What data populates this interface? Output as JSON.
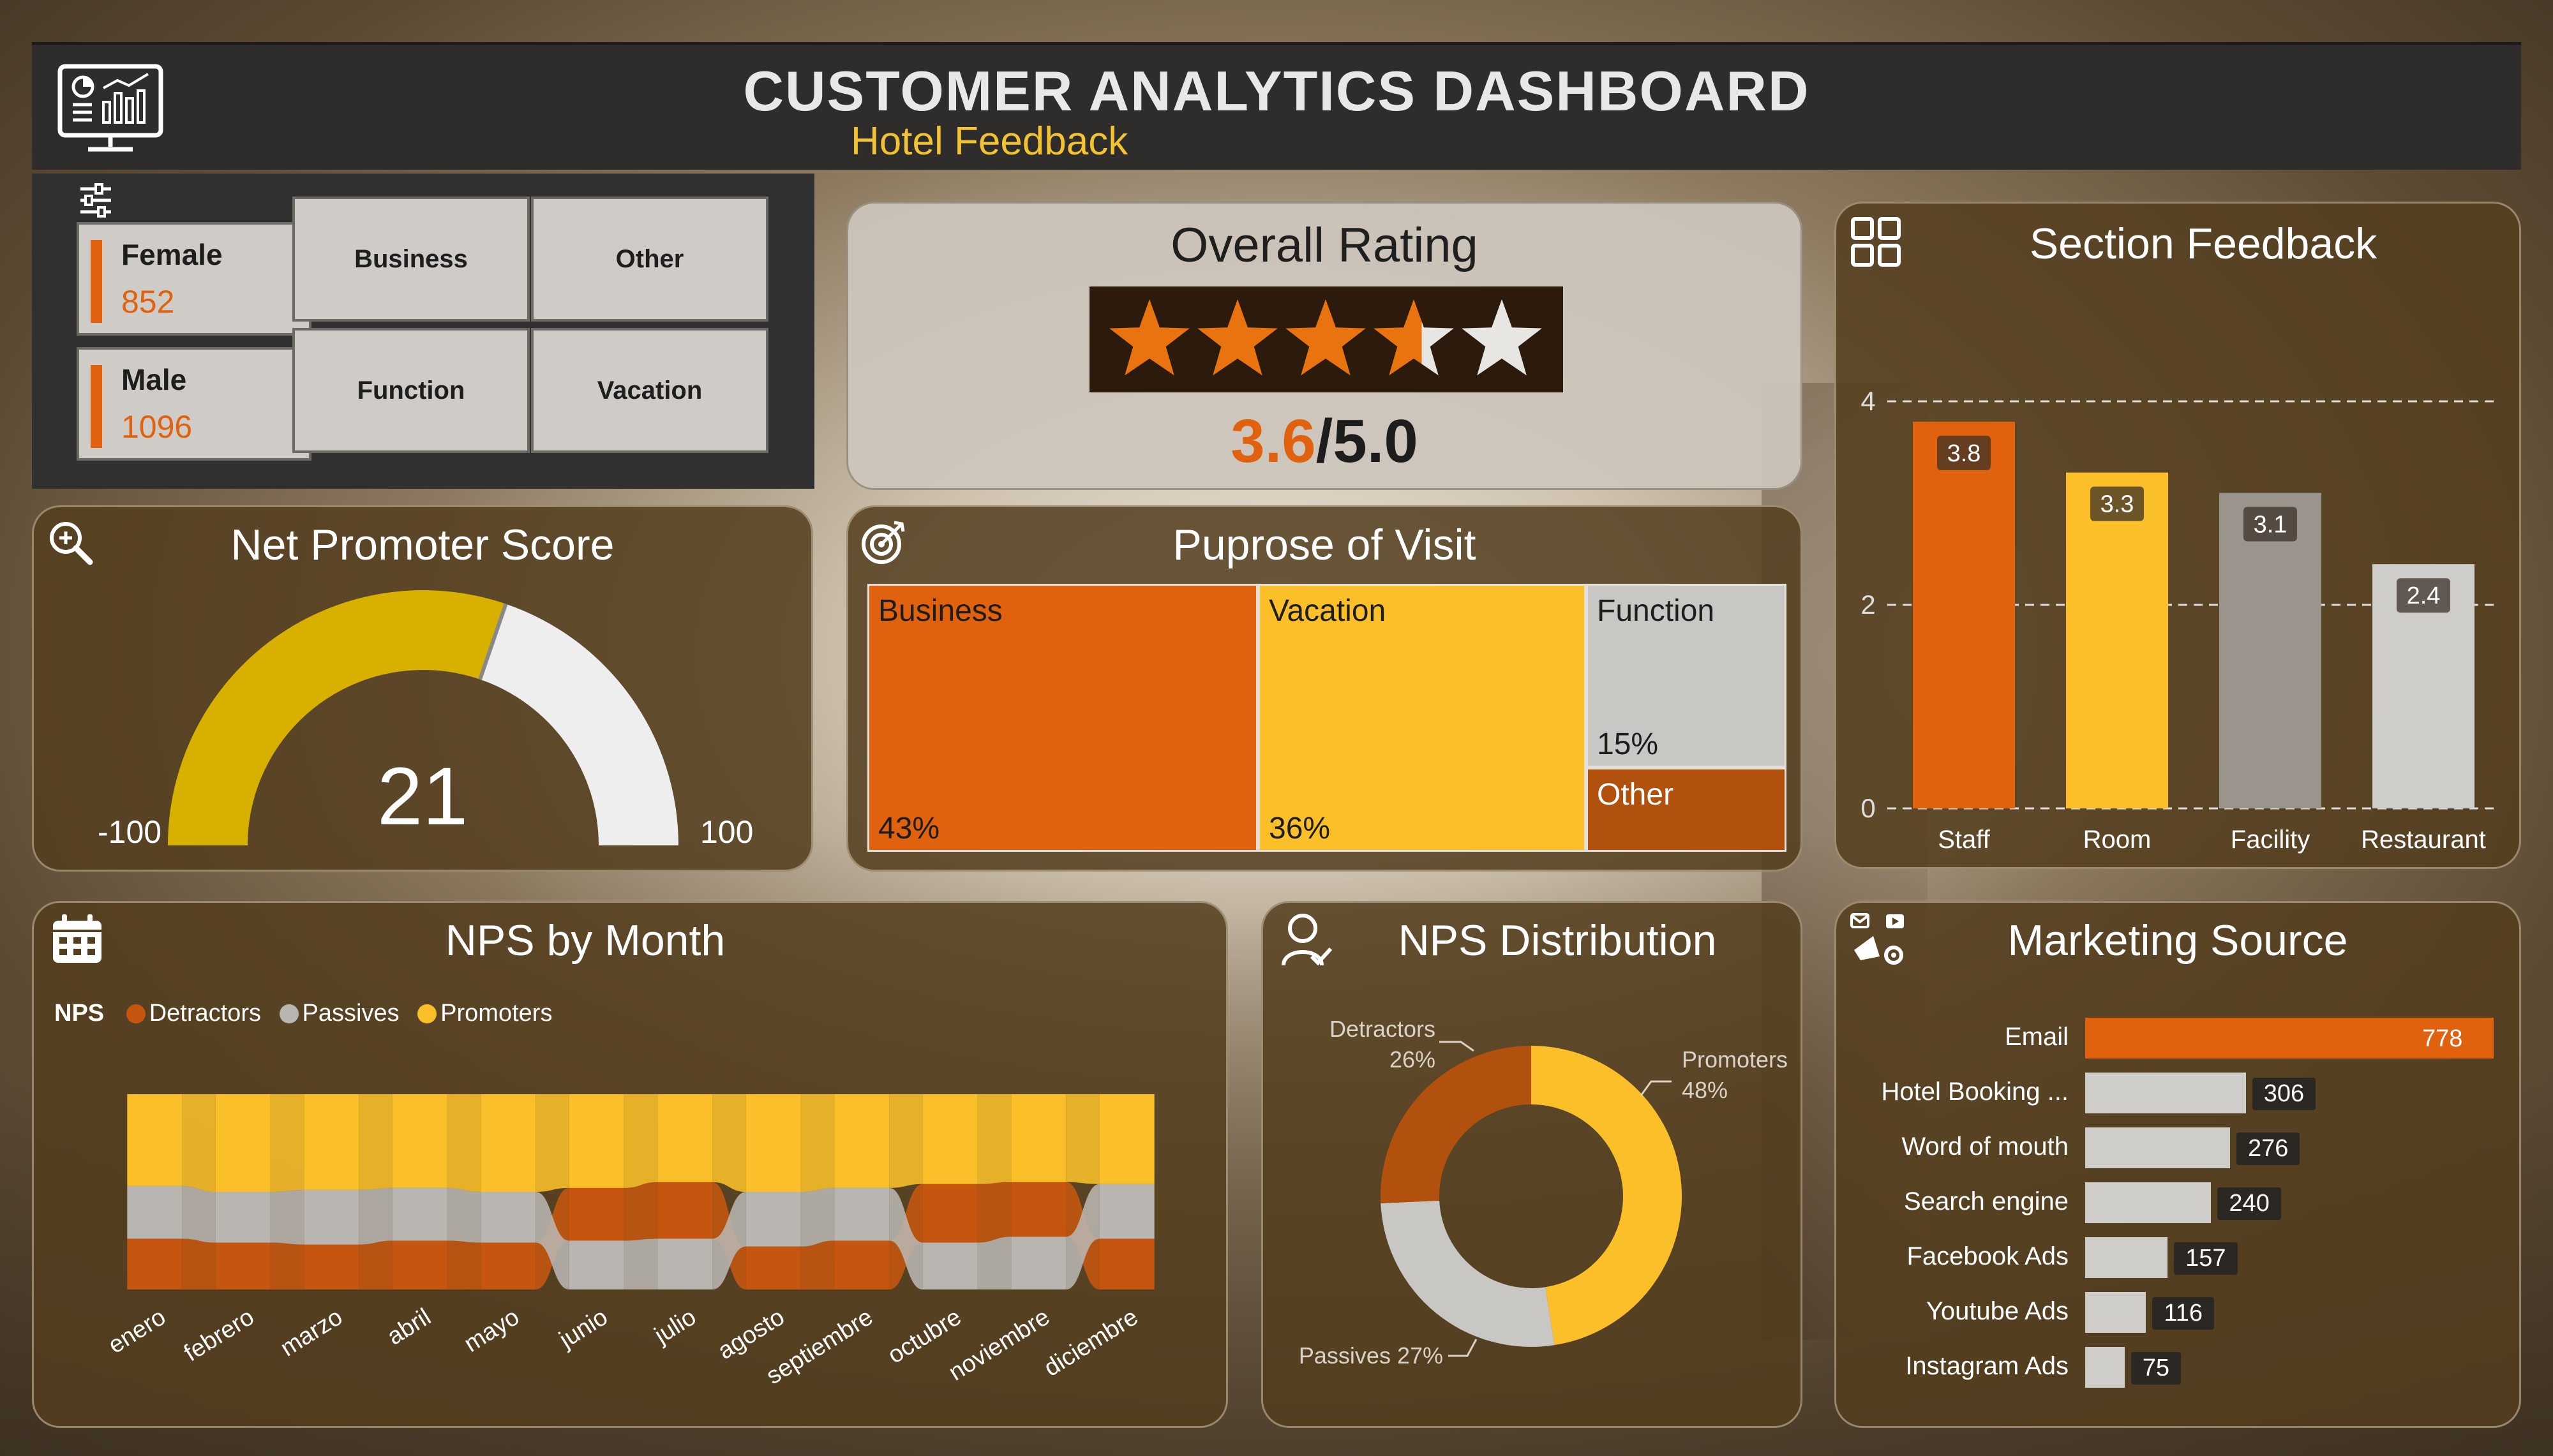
{
  "header": {
    "title": "CUSTOMER ANALYTICS DASHBOARD",
    "subtitle": "Hotel Feedback"
  },
  "slicers": {
    "gender": [
      {
        "label": "Female",
        "value": "852"
      },
      {
        "label": "Male",
        "value": "1096"
      }
    ],
    "purpose": [
      "Business",
      "Other",
      "Function",
      "Vacation"
    ]
  },
  "overall_rating": {
    "title": "Overall Rating",
    "score": "3.6",
    "max": "/5.0",
    "stars_filled_fraction": 0.72
  },
  "nps_gauge": {
    "title": "Net Promoter Score",
    "value": "21",
    "min_label": "-100",
    "max_label": "100",
    "min": -100,
    "max": 100,
    "score": 21,
    "colors": {
      "fill": "#d8b100",
      "rest": "#eeeeee"
    }
  },
  "purpose_of_visit": {
    "title": "Puprose of Visit",
    "cells": [
      {
        "label": "Business",
        "pct": "43%",
        "color": "#e0620f"
      },
      {
        "label": "Vacation",
        "pct": "36%",
        "color": "#fbbf2a"
      },
      {
        "label": "Function",
        "pct": "15%",
        "color": "#c9c7c4"
      },
      {
        "label": "Other",
        "pct": "",
        "color": "#b2500d"
      }
    ]
  },
  "section_feedback": {
    "title": "Section Feedback",
    "chart_data": {
      "type": "bar",
      "categories": [
        "Staff",
        "Room",
        "Facility",
        "Restaurant"
      ],
      "values": [
        3.8,
        3.3,
        3.1,
        2.4
      ],
      "value_labels": [
        "3.8",
        "3.3",
        "3.1",
        "2.4"
      ],
      "yticks": [
        "0",
        "2",
        "4"
      ],
      "ylim": [
        0,
        4
      ],
      "colors": [
        "#e0620f",
        "#fbbf2a",
        "#9a948d",
        "#cfcdca"
      ],
      "grid": true
    }
  },
  "nps_by_month": {
    "title": "NPS by Month",
    "legend_title": "NPS",
    "legend": [
      {
        "name": "Detractors",
        "color": "#c6560f"
      },
      {
        "name": "Passives",
        "color": "#b9b6b1"
      },
      {
        "name": "Promoters",
        "color": "#fbbf2a"
      }
    ],
    "chart_data": {
      "type": "area",
      "x": [
        "enero",
        "febrero",
        "marzo",
        "abril",
        "mayo",
        "junio",
        "julio",
        "agosto",
        "septiembre",
        "octubre",
        "noviembre",
        "diciembre"
      ],
      "series": [
        {
          "name": "Detractors",
          "values": [
            26,
            24,
            23,
            25,
            24,
            27,
            29,
            22,
            25,
            30,
            28,
            26
          ]
        },
        {
          "name": "Passives",
          "values": [
            27,
            26,
            28,
            27,
            26,
            25,
            26,
            28,
            27,
            24,
            27,
            28
          ]
        },
        {
          "name": "Promoters",
          "values": [
            47,
            50,
            49,
            48,
            50,
            48,
            45,
            50,
            48,
            46,
            45,
            46
          ]
        }
      ],
      "stacking": "ribbon-100"
    }
  },
  "nps_distribution": {
    "title": "NPS Distribution",
    "chart_data": {
      "type": "pie",
      "donut": true,
      "slices": [
        {
          "name": "Promoters",
          "value": 48,
          "label": "Promoters",
          "pct": "48%",
          "color": "#fbbf2a"
        },
        {
          "name": "Passives",
          "value": 27,
          "label": "Passives 27%",
          "pct": "",
          "color": "#c9c7c4"
        },
        {
          "name": "Detractors",
          "value": 26,
          "label": "Detractors",
          "pct": "26%",
          "color": "#b2500d"
        }
      ]
    }
  },
  "marketing_source": {
    "title": "Marketing Source",
    "chart_data": {
      "type": "bar",
      "orientation": "horizontal",
      "categories": [
        "Email",
        "Hotel Booking ...",
        "Word of mouth",
        "Search engine",
        "Facebook Ads",
        "Youtube Ads",
        "Instagram Ads"
      ],
      "values": [
        778,
        306,
        276,
        240,
        157,
        116,
        75
      ],
      "value_labels": [
        "778",
        "306",
        "276",
        "240",
        "157",
        "116",
        "75"
      ],
      "colors": {
        "highlight": "#e0620f",
        "default": "#cfcdca"
      }
    }
  }
}
